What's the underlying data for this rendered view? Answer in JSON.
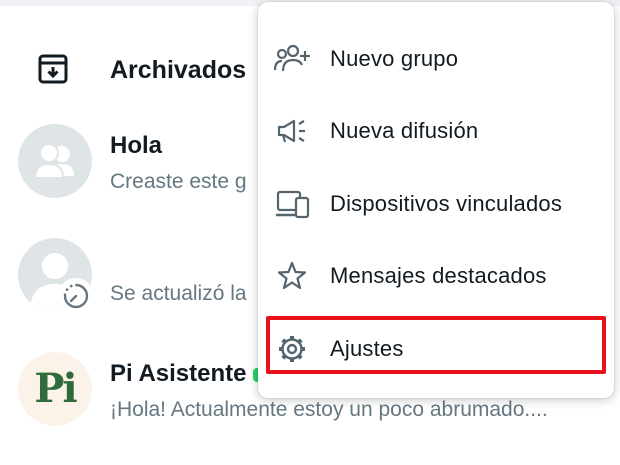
{
  "archived": {
    "label": "Archivados",
    "icon": "archive-box-icon"
  },
  "chats": [
    {
      "name": "Hola",
      "preview": "Creaste este g",
      "avatar_icon": "group-avatar-icon"
    },
    {
      "name": "",
      "preview": "Se actualizó la",
      "avatar_icon": "person-avatar-icon",
      "badge_icon": "status-timer-icon"
    },
    {
      "name": "Pi Asistente",
      "preview": "¡Hola! Actualmente estoy un poco abrumado....",
      "avatar_text": "Pi"
    }
  ],
  "menu": {
    "items": [
      {
        "label": "Nuevo grupo",
        "icon": "add-group-icon"
      },
      {
        "label": "Nueva difusión",
        "icon": "broadcast-megaphone-icon"
      },
      {
        "label": "Dispositivos vinculados",
        "icon": "linked-devices-icon"
      },
      {
        "label": "Mensajes destacados",
        "icon": "star-icon"
      },
      {
        "label": "Ajustes",
        "icon": "gear-icon"
      }
    ],
    "highlighted_item": "Ajustes"
  },
  "colors": {
    "highlight_border": "#e8101a",
    "avatar_bg": "#dfe5e7",
    "secondary_text": "#667781",
    "pi_green": "#2f6c3a",
    "icon_gray": "#54656f"
  }
}
